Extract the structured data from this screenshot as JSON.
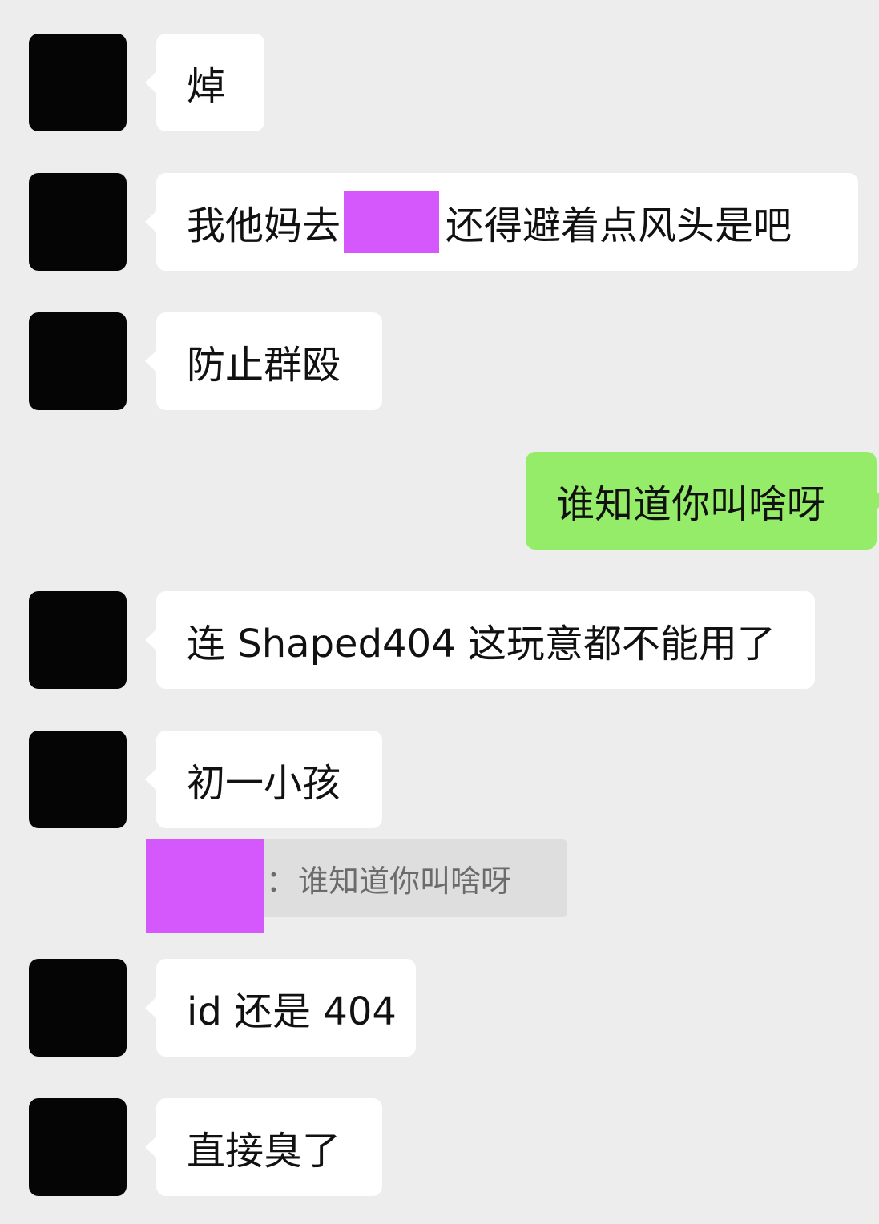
{
  "messages": [
    {
      "side": "incoming",
      "text": "焯"
    },
    {
      "side": "incoming",
      "before": "我他妈去",
      "after": "还得避着点风头是吧"
    },
    {
      "side": "incoming",
      "text": "防止群殴"
    },
    {
      "side": "outgoing",
      "text": "谁知道你叫啥呀"
    },
    {
      "side": "incoming",
      "text": "连 Shaped404 这玩意都不能用了"
    },
    {
      "side": "incoming",
      "text": "初一小孩"
    },
    {
      "side": "incoming",
      "text": "id 还是 404"
    },
    {
      "side": "incoming",
      "text": "直接臭了"
    }
  ],
  "quote": {
    "separator": "：",
    "text": "谁知道你叫啥呀"
  },
  "colors": {
    "background": "#ededed",
    "incoming_bubble": "#ffffff",
    "outgoing_bubble": "#95ec69",
    "redaction": "#d458fb",
    "quote_background": "#dedede",
    "avatar": "#050505"
  }
}
